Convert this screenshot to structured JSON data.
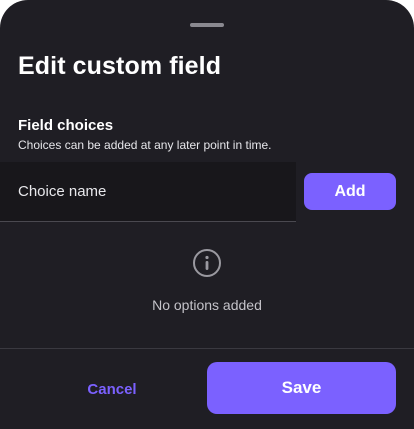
{
  "dialog": {
    "title": "Edit custom field"
  },
  "field_choices": {
    "label": "Field choices",
    "hint": "Choices can be added at any later point in time.",
    "input_placeholder": "Choice name",
    "add_label": "Add"
  },
  "empty_state": {
    "icon": "info-icon",
    "message": "No options added"
  },
  "footer": {
    "cancel_label": "Cancel",
    "save_label": "Save"
  },
  "colors": {
    "sheet_background": "#1f1e24",
    "input_background": "#18171b",
    "accent": "#7b61ff"
  }
}
